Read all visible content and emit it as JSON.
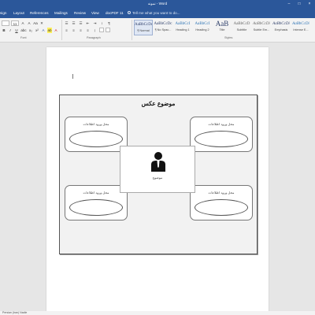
{
  "window": {
    "title": "نمونه - Word",
    "minimize": "–",
    "maximize": "□",
    "close": "×"
  },
  "menu": {
    "items": [
      "sign",
      "Layout",
      "References",
      "Mailings",
      "Review",
      "View",
      "docPDF 11"
    ],
    "tell_me": "Tell me what you want to do..."
  },
  "ribbon": {
    "font_name": "",
    "font_size": "11",
    "groups": {
      "font": "Font",
      "paragraph": "Paragraph",
      "styles": "Styles"
    },
    "styles": [
      {
        "preview": "AaBbCcDc",
        "name": "¶ Normal"
      },
      {
        "preview": "AaBbCcDc",
        "name": "¶ No Spac..."
      },
      {
        "preview": "AaBbCcI",
        "name": "Heading 1"
      },
      {
        "preview": "AaBbCcI",
        "name": "Heading 2"
      },
      {
        "preview": "AaB",
        "name": "Title"
      },
      {
        "preview": "AaBbCcD",
        "name": "Subtitle"
      },
      {
        "preview": "AaBbCcDi",
        "name": "Subtle Em..."
      },
      {
        "preview": "AaBbCcDi",
        "name": "Emphasis"
      },
      {
        "preview": "AaBbCcDi",
        "name": "Intense E..."
      }
    ]
  },
  "document": {
    "panel_title": "موضوع عکس",
    "notes": [
      "محل ورود اطلاعات",
      "محل ورود اطلاعات",
      "محل ورود اطلاعات",
      "محل ورود اطلاعات"
    ],
    "center_label": "موضوع"
  },
  "status": {
    "text": "Persian (Iran) Nadie"
  },
  "colors": {
    "accent": "#2b579a",
    "ribbon": "#f3f3f3",
    "canvas": "#e6e6e6"
  }
}
